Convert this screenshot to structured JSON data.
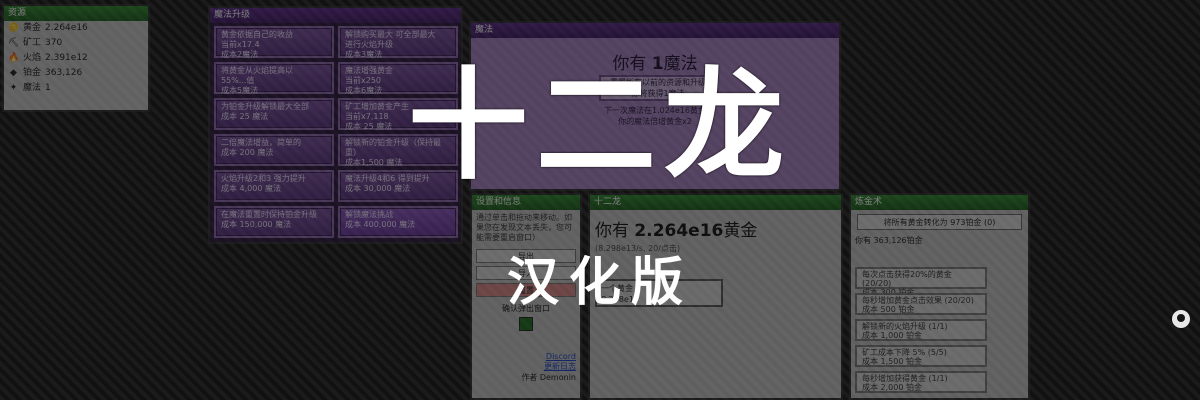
{
  "resources": {
    "title": "资源",
    "items": [
      {
        "icon": "gold-icon",
        "glyph": "🪙",
        "label": "黄金",
        "value": "2.264e16"
      },
      {
        "icon": "miner-icon",
        "glyph": "⛏",
        "label": "矿工",
        "value": "370"
      },
      {
        "icon": "fire-icon",
        "glyph": "🔥",
        "label": "火焰",
        "value": "2.391e12"
      },
      {
        "icon": "platinum-icon",
        "glyph": "◆",
        "label": "铂金",
        "value": "363,126"
      },
      {
        "icon": "magic-icon",
        "glyph": "✦",
        "label": "魔法",
        "value": "1"
      }
    ]
  },
  "magic_upgrades": {
    "title": "魔法升级",
    "buttons": [
      {
        "l1": "黄金依据自己的收益",
        "l2": "当前x17.4",
        "l3": "成本2魔法"
      },
      {
        "l1": "解锁购买最大 可全部最大",
        "l2": "进行火焰升级",
        "l3": "成本3魔法"
      },
      {
        "l1": "将黄金从火焰提高以",
        "l2": "55%...值",
        "l3": "成本5魔法"
      },
      {
        "l1": "魔法增强黄金",
        "l2": "当前x250",
        "l3": "成本6魔法"
      },
      {
        "l1": "为铂金升级解锁最大全部",
        "l2": "成本 25 魔法",
        "l3": ""
      },
      {
        "l1": "矿工增加黄金产生",
        "l2": "当前x7,118",
        "l3": "成本 25 魔法"
      },
      {
        "l1": "二倍魔法增益，简单的",
        "l2": "成本 200 魔法",
        "l3": ""
      },
      {
        "l1": "解锁新的铂金升级（保持最",
        "l2": "重）",
        "l3": "成本1,500 魔法"
      },
      {
        "l1": "火焰升级2和3 强力提升",
        "l2": "成本 4,000 魔法",
        "l3": ""
      },
      {
        "l1": "魔法升级4和6 得到提升",
        "l2": "成本 30,000 魔法",
        "l3": ""
      },
      {
        "l1": "在魔法重置时保持铂金升级",
        "l2": "成本 150,000 魔法",
        "l3": ""
      },
      {
        "l1": "解锁魔法挑战",
        "l2": "成本 400,000 魔法",
        "l3": ""
      }
    ]
  },
  "magic": {
    "title": "魔法",
    "have_prefix": "你有",
    "have_value": "1",
    "have_suffix": "魔法",
    "reset_btn_l1": "重置所有以前的资源和升级",
    "reset_btn_l2": "你将获得1魔法",
    "line1": "下一次魔法在1.024e16黄金",
    "line2": "你的魔法倍增黄金x2"
  },
  "settings": {
    "title": "设置和信息",
    "text": "通过单击和拖动来移动。如果您在发现文本丢失，您可能需要重启窗口）",
    "buttons": [
      "导出",
      "导入",
      "重置"
    ],
    "confirm": "确认弹出窗口",
    "discord": "Discord",
    "changelog": "更新日志",
    "author": "作者 Demonin"
  },
  "dragons": {
    "title": "十二龙",
    "have_prefix": "你有",
    "have_value": "2.264e16",
    "have_suffix": "黄金",
    "rate": "(8.298e13/s, 20/点击)",
    "btn_l1": "一个黄金",
    "btn_l2": "8.298e12"
  },
  "alchemy": {
    "title": "炼金术",
    "convert_btn": "将所有黄金转化为 973铂金 (0)",
    "have_line": "你有 363,126铂金",
    "upgrades": [
      {
        "l1": "每次点击获得20%的黄金 (20/20)",
        "l2": "成本 300 铂金"
      },
      {
        "l1": "每秒增加黄金点击效果 (20/20)",
        "l2": "成本 500 铂金"
      },
      {
        "l1": "解锁新的火焰升级 (1/1)",
        "l2": "成本 1,000 铂金"
      },
      {
        "l1": "矿工成本下降 5% (5/5)",
        "l2": "成本 1,500 铂金"
      },
      {
        "l1": "每秒增加获得黄金 (1/1)",
        "l2": "成本 2,000 铂金"
      }
    ]
  },
  "overlay": {
    "title": "十二龙",
    "subtitle": "汉化版"
  },
  "colors": {
    "green_header": "#2e8a2e",
    "purple_header": "#5c2a8c",
    "purple_button": "#6a4190"
  }
}
